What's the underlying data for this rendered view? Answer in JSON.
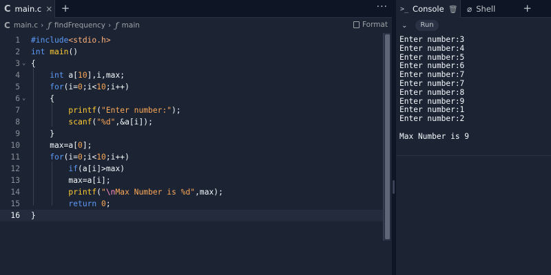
{
  "editor": {
    "tab": {
      "label": "main.c",
      "close": "×"
    },
    "tab_add": "+",
    "more": "···",
    "breadcrumb": {
      "file": "main.c",
      "func1": "findFrequency",
      "func2": "main"
    },
    "format_label": "Format",
    "active_line": 16,
    "lines": [
      {
        "n": "1",
        "html": "<span class=\"pp\">#include</span><span class=\"hdr\">&lt;stdio.h&gt;</span>"
      },
      {
        "n": "2",
        "html": "<span class=\"kw\">int</span> <span class=\"fnc\">main</span>()"
      },
      {
        "n": "3",
        "html": "{",
        "fold": true
      },
      {
        "n": "4",
        "html": "    <span class=\"kw\">int</span> a[<span class=\"num\">10</span>],i,max;"
      },
      {
        "n": "5",
        "html": "    <span class=\"kw\">for</span>(i=<span class=\"num\">0</span>;i&lt;<span class=\"num\">10</span>;i++)"
      },
      {
        "n": "6",
        "html": "    {",
        "fold": true
      },
      {
        "n": "7",
        "html": "        <span class=\"fnc\">printf</span>(<span class=\"str\">\"Enter number:\"</span>);"
      },
      {
        "n": "8",
        "html": "        <span class=\"fnc\">scanf</span>(<span class=\"str\">\"%d\"</span>,&amp;a[i]);"
      },
      {
        "n": "9",
        "html": "    }"
      },
      {
        "n": "10",
        "html": "    max=a[<span class=\"num\">0</span>];"
      },
      {
        "n": "11",
        "html": "    <span class=\"kw\">for</span>(i=<span class=\"num\">0</span>;i&lt;<span class=\"num\">10</span>;i++)"
      },
      {
        "n": "12",
        "html": "        <span class=\"kw\">if</span>(a[i]&gt;max)"
      },
      {
        "n": "13",
        "html": "        max=a[i];"
      },
      {
        "n": "14",
        "html": "        <span class=\"fnc\">printf</span>(<span class=\"str\">\"<span class=\"esc\">\\n</span>Max Number is %d\"</span>,max);"
      },
      {
        "n": "15",
        "html": "        <span class=\"kw\">return</span> <span class=\"num\">0</span>;"
      },
      {
        "n": "16",
        "html": "}"
      }
    ]
  },
  "console": {
    "tabs": [
      {
        "label": "Console",
        "icon": "terminal-icon"
      },
      {
        "label": "Shell",
        "icon": "shell-icon"
      }
    ],
    "tab_add": "+",
    "run_label": "Run",
    "output": [
      "Enter number:3",
      "Enter number:4",
      "Enter number:5",
      "Enter number:6",
      "Enter number:7",
      "Enter number:7",
      "Enter number:8",
      "Enter number:9",
      "Enter number:1",
      "Enter number:2",
      "",
      "Max Number is 9"
    ]
  },
  "colors": {
    "bg": "#1c2333",
    "tabbar": "#0e1525",
    "keyword": "#5d9bf9",
    "string": "#fba857",
    "function": "#ffcc33"
  }
}
